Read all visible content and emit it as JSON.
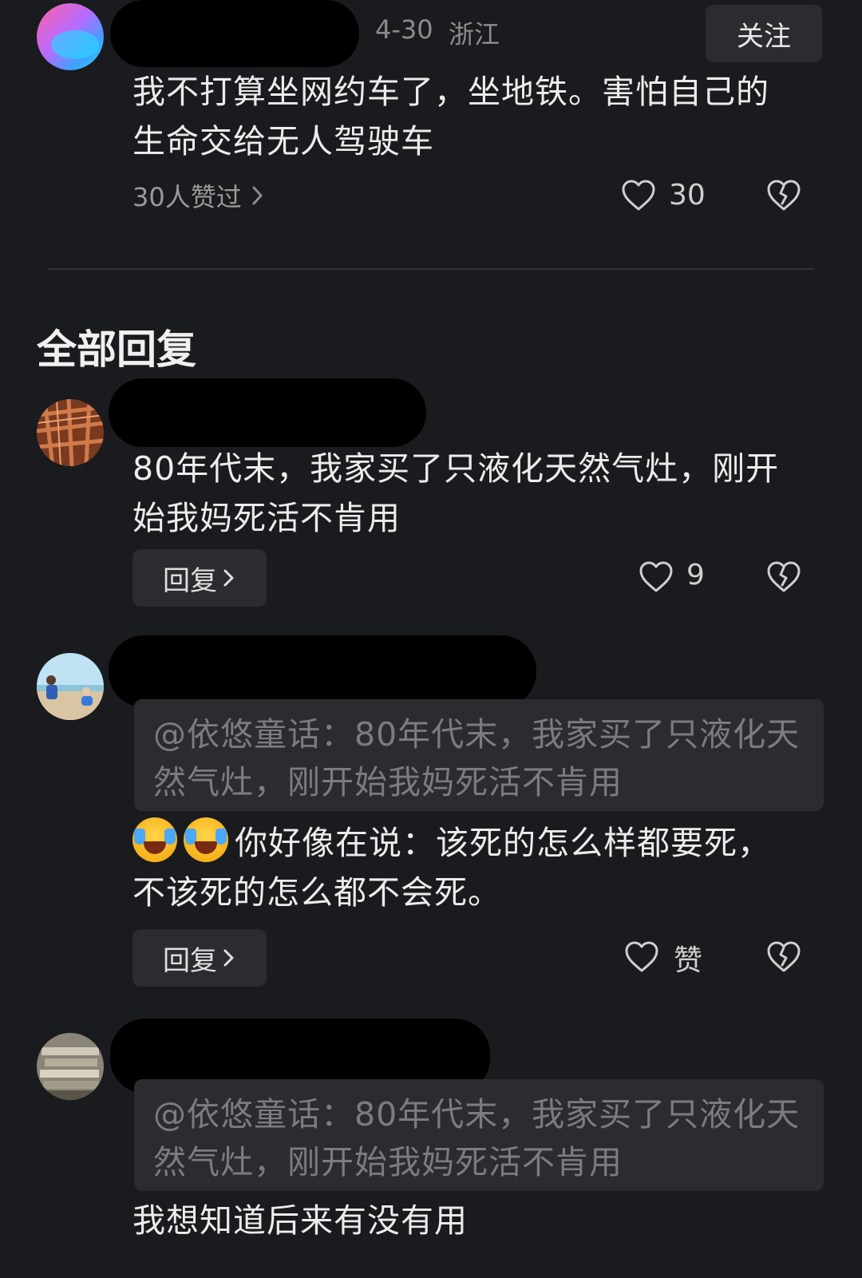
{
  "main_comment": {
    "date": "4-30",
    "location": "浙江",
    "follow_label": "关注",
    "text": "我不打算坐网约车了，坐地铁。害怕自己的生命交给无人驾驶车",
    "likes_summary": "30人赞过",
    "like_count": "30"
  },
  "section_title": "全部回复",
  "replies": [
    {
      "text": "80年代末，我家买了只液化天然气灶，刚开始我妈死活不肯用",
      "reply_label": "回复",
      "like_count": "9"
    },
    {
      "quote": "@依悠童话：80年代末，我家买了只液化天然气灶，刚开始我妈死活不肯用",
      "text": "你好像在说：该死的怎么样都要死，不该死的怎么都不会死。",
      "emojis": [
        "crying-laughing-emoji",
        "crying-laughing-emoji"
      ],
      "reply_label": "回复",
      "like_label": "赞"
    },
    {
      "quote": "@依悠童话：80年代末，我家买了只液化天然气灶，刚开始我妈死活不肯用",
      "text": "我想知道后来有没有用"
    }
  ],
  "icons": {
    "like": "heart-outline-icon",
    "dislike": "broken-heart-icon",
    "chevron": "chevron-right-icon"
  }
}
